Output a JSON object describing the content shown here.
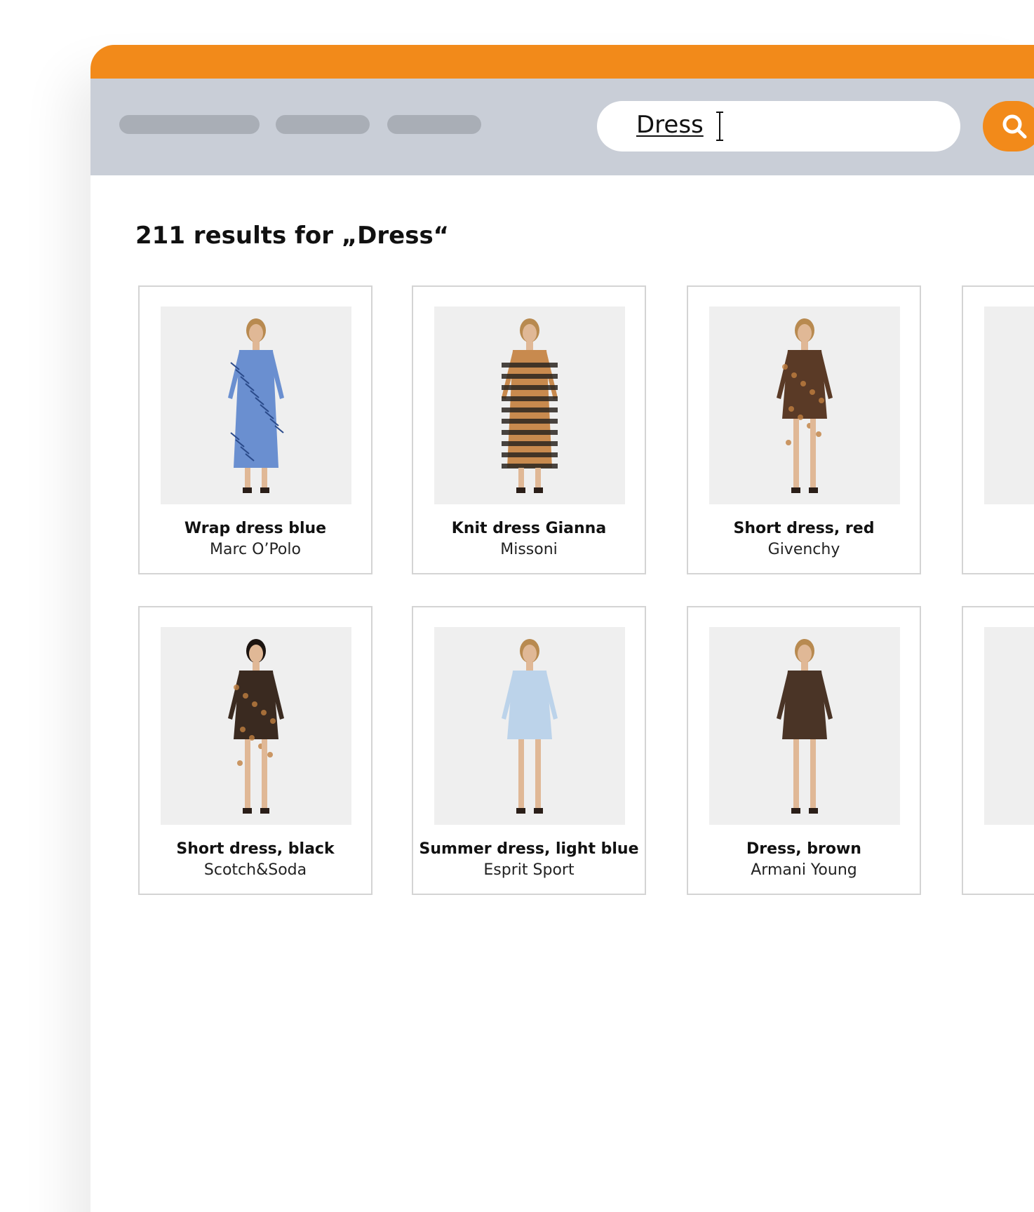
{
  "browser": {
    "accent_color": "#f28a1a",
    "toolbar_color": "#c9ced7",
    "nav_placeholders": [
      "nav-placeholder-1",
      "nav-placeholder-2",
      "nav-placeholder-3"
    ]
  },
  "search": {
    "value": "Dress",
    "button_icon": "search-icon"
  },
  "results": {
    "title": "211 results for „Dress“"
  },
  "products": [
    {
      "name": "Wrap dress blue",
      "brand": "Marc O’Polo",
      "dress_color": "#6a8fd0",
      "pattern": "blue-print"
    },
    {
      "name": "Knit dress Gianna",
      "brand": "Missoni",
      "dress_color": "#c88a4e",
      "pattern": "stripes"
    },
    {
      "name": "Short dress, red",
      "brand": "Givenchy",
      "dress_color": "#5a3a26",
      "pattern": "dark-print"
    },
    {
      "name": "",
      "brand": "",
      "dress_color": "#efefef",
      "pattern": "cut-off"
    },
    {
      "name": "Short dress, black",
      "brand": "Scotch&Soda",
      "dress_color": "#3a2a20",
      "pattern": "dark-print"
    },
    {
      "name": "Summer dress, light blue",
      "brand": "Esprit Sport",
      "dress_color": "#bcd3ea",
      "pattern": "plain"
    },
    {
      "name": "Dress, brown",
      "brand": "Armani Young",
      "dress_color": "#4a3426",
      "pattern": "plain"
    },
    {
      "name": "",
      "brand": "",
      "dress_color": "#efefef",
      "pattern": "cut-off"
    }
  ]
}
